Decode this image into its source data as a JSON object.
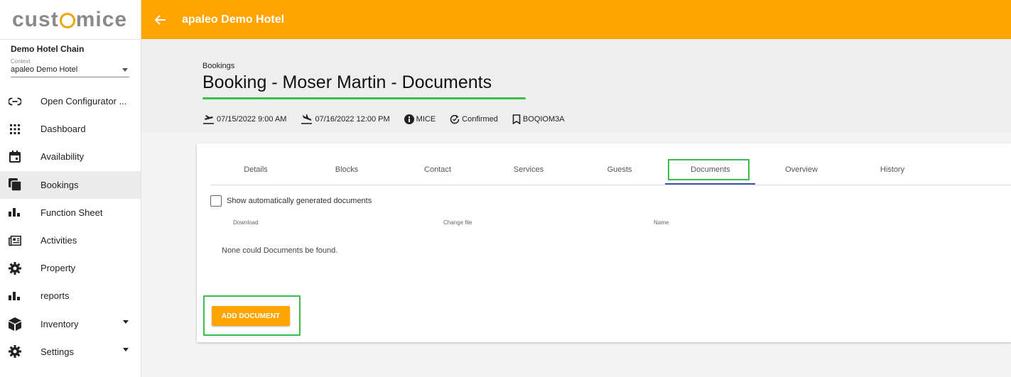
{
  "brand": {
    "logo_pre": "cust",
    "logo_post": "mice",
    "accent": "#ffa400",
    "highlight": "#3bbf4a"
  },
  "sidebar": {
    "chain": "Demo Hotel Chain",
    "context_label": "Context",
    "context_value": "apaleo Demo Hotel",
    "items": [
      {
        "label": "Open Configurator ...",
        "icon": "link-icon"
      },
      {
        "label": "Dashboard",
        "icon": "grid-icon"
      },
      {
        "label": "Availability",
        "icon": "calendar-icon"
      },
      {
        "label": "Bookings",
        "icon": "bookings-icon"
      },
      {
        "label": "Function Sheet",
        "icon": "bar-chart-icon"
      },
      {
        "label": "Activities",
        "icon": "newspaper-icon"
      },
      {
        "label": "Property",
        "icon": "gear-icon"
      },
      {
        "label": "reports",
        "icon": "bar-chart-icon"
      },
      {
        "label": "Inventory",
        "icon": "cube-icon"
      },
      {
        "label": "Settings",
        "icon": "gear-icon"
      }
    ]
  },
  "topbar": {
    "title": "apaleo Demo Hotel"
  },
  "header": {
    "breadcrumb": "Bookings",
    "title": "Booking -  Moser Martin - Documents",
    "arrival": "07/15/2022 9:00 AM",
    "departure": "07/16/2022 12:00 PM",
    "type": "MICE",
    "status": "Confirmed",
    "code": "BOQIOM3A"
  },
  "tabs": [
    "Details",
    "Blocks",
    "Contact",
    "Services",
    "Guests",
    "Documents",
    "Overview",
    "History"
  ],
  "documents": {
    "show_auto_label": "Show automatically generated documents",
    "columns": [
      "Download",
      "Change file",
      "Name"
    ],
    "empty_text": "None could Documents be found.",
    "add_label": "ADD DOCUMENT"
  }
}
